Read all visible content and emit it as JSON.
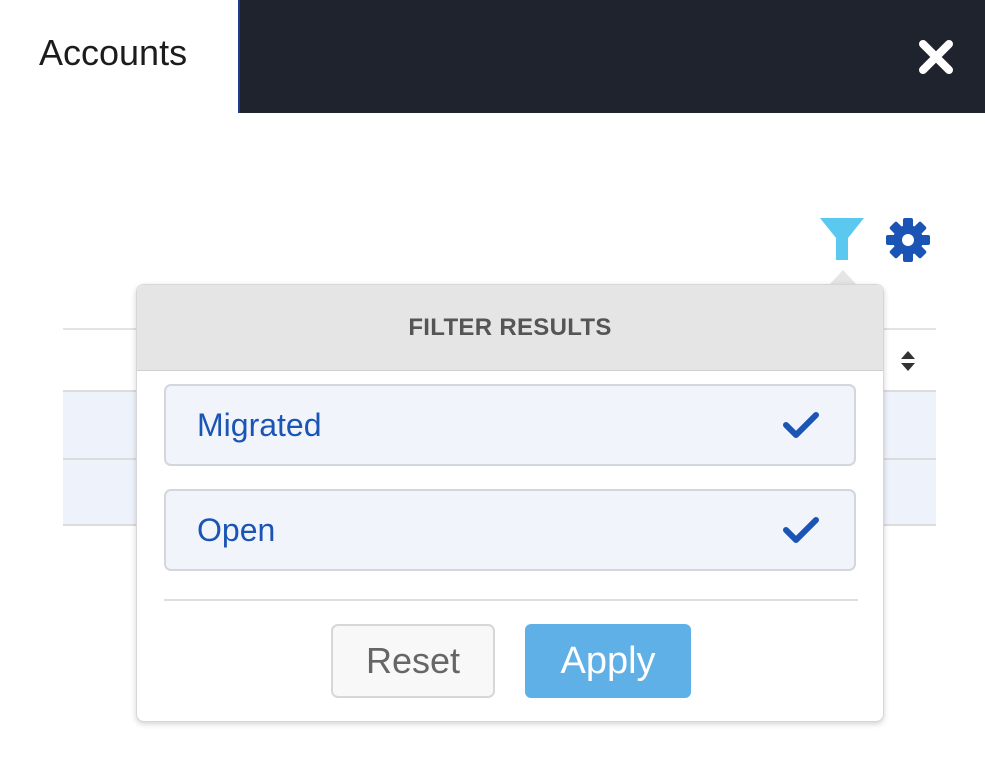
{
  "header": {
    "tab_title": "Accounts",
    "close_icon": "close-icon"
  },
  "toolbar": {
    "filter_icon": "filter-icon",
    "settings_icon": "gear-icon"
  },
  "filter_popover": {
    "title": "FILTER RESULTS",
    "options": [
      {
        "label": "Migrated",
        "checked": true
      },
      {
        "label": "Open",
        "checked": true
      }
    ],
    "reset_label": "Reset",
    "apply_label": "Apply"
  },
  "colors": {
    "topbar": "#1f232d",
    "accent_blue": "#1a55b5",
    "filter_active": "#5bc8f0",
    "apply_button": "#5fb0e6"
  }
}
